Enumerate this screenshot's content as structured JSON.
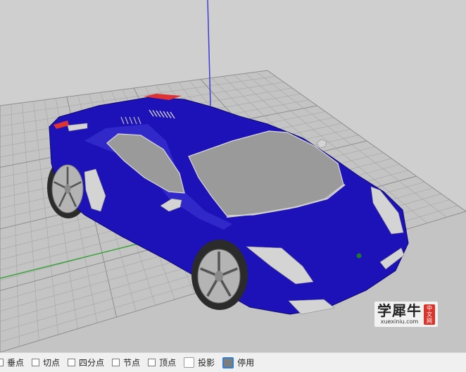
{
  "viewport": {
    "name": "3D perspective viewport",
    "background_color": "#cfcfcf",
    "grid_color": "#a9a9a9",
    "grid_major_color": "#8e8e8e",
    "axis_colors": {
      "x": "#c53b3b",
      "y": "#3aa33a",
      "z": "#3d3dd6"
    },
    "model": {
      "body_color": "#1c12b8",
      "glass_color": "#9a9a9a",
      "rim_color": "#b4b4b4",
      "tire_color": "#2b2b2b",
      "light_color": "#d4d4d4"
    }
  },
  "watermark": {
    "chinese_text": "学犀牛",
    "url_text": "xuexiniu.com",
    "seal_chars": [
      "中",
      "文",
      "网"
    ],
    "seal_color": "#d9342b"
  },
  "statusbar": {
    "items": [
      {
        "label": "垂点",
        "checked": false
      },
      {
        "label": "切点",
        "checked": false
      },
      {
        "label": "四分点",
        "checked": false
      },
      {
        "label": "节点",
        "checked": false
      },
      {
        "label": "顶点",
        "checked": false
      },
      {
        "label": "投影",
        "checked": false
      },
      {
        "label": "停用",
        "checked": true
      }
    ]
  }
}
